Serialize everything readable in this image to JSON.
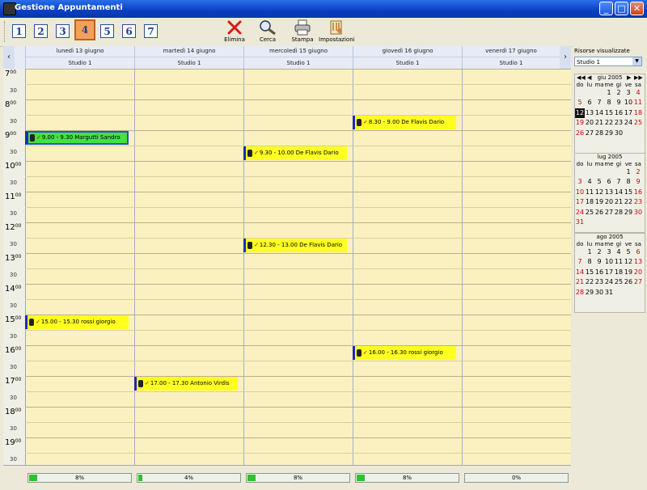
{
  "window": {
    "title": "Gestione Appuntamenti"
  },
  "toolbar": {
    "day_buttons": [
      "1",
      "2",
      "3",
      "4",
      "5",
      "6",
      "7"
    ],
    "active_day": "4",
    "tools": [
      {
        "label": "Elimina",
        "icon": "delete-x-icon"
      },
      {
        "label": "Cerca",
        "icon": "search-icon"
      },
      {
        "label": "Stampa",
        "icon": "printer-icon"
      },
      {
        "label": "Impostazioni",
        "icon": "settings-icon"
      }
    ]
  },
  "calendar": {
    "days": [
      {
        "name": "lunedì 13 giugno",
        "studio": "Studio 1",
        "load": "8%",
        "load_value": 0.08
      },
      {
        "name": "martedì 14 giugno",
        "studio": "Studio 1",
        "load": "4%",
        "load_value": 0.04
      },
      {
        "name": "mercoledì 15 giugno",
        "studio": "Studio 1",
        "load": "8%",
        "load_value": 0.08
      },
      {
        "name": "giovedì 16 giugno",
        "studio": "Studio 1",
        "load": "8%",
        "load_value": 0.08
      },
      {
        "name": "venerdì 17 giugno",
        "studio": "Studio 1",
        "load": "0%",
        "load_value": 0
      }
    ],
    "hours": [
      "7",
      "8",
      "9",
      "10",
      "11",
      "12",
      "13",
      "14",
      "15",
      "16",
      "17",
      "18",
      "19"
    ],
    "hour_suffix": "00",
    "half_label": "30",
    "appointments": [
      {
        "day": 0,
        "start": "9.00",
        "text": "9.00 - 9.30 Margutti Sandro",
        "selected": true
      },
      {
        "day": 3,
        "start": "8.30",
        "text": "8.30 - 9.00 De Flavis Dario",
        "selected": false
      },
      {
        "day": 2,
        "start": "9.30",
        "text": "9.30 - 10.00 De Flavis Dario",
        "selected": false
      },
      {
        "day": 2,
        "start": "12.30",
        "text": "12.30 - 13.00 De Flavis Dario",
        "selected": false
      },
      {
        "day": 0,
        "start": "15.00",
        "text": "15.00 - 15.30 rossi giorgio",
        "selected": false
      },
      {
        "day": 3,
        "start": "16.00",
        "text": "16.00 - 16.30 rossi giorgio",
        "selected": false
      },
      {
        "day": 1,
        "start": "17.00",
        "text": "17.00 - 17.30 Antonio Virdis",
        "selected": false
      }
    ]
  },
  "resources": {
    "label": "Risorse visualizzate",
    "selected": "Studio 1"
  },
  "mini_calendars": [
    {
      "title": "giu 2005",
      "weekdays": [
        "do",
        "lu",
        "ma",
        "me",
        "gi",
        "ve",
        "sa"
      ],
      "cells": [
        "",
        "",
        "",
        "1",
        "2",
        "3",
        "4",
        "5",
        "6",
        "7",
        "8",
        "9",
        "10",
        "11",
        "12",
        "13",
        "14",
        "15",
        "16",
        "17",
        "18",
        "19",
        "20",
        "21",
        "22",
        "23",
        "24",
        "25",
        "26",
        "27",
        "28",
        "29",
        "30",
        "",
        ""
      ],
      "today": "12"
    },
    {
      "title": "lug 2005",
      "weekdays": [
        "do",
        "lu",
        "ma",
        "me",
        "gi",
        "ve",
        "sa"
      ],
      "cells": [
        "",
        "",
        "",
        "",
        "",
        "1",
        "2",
        "3",
        "4",
        "5",
        "6",
        "7",
        "8",
        "9",
        "10",
        "11",
        "12",
        "13",
        "14",
        "15",
        "16",
        "17",
        "18",
        "19",
        "20",
        "21",
        "22",
        "23",
        "24",
        "25",
        "26",
        "27",
        "28",
        "29",
        "30",
        "31"
      ]
    },
    {
      "title": "ago 2005",
      "weekdays": [
        "do",
        "lu",
        "ma",
        "me",
        "gi",
        "ve",
        "sa"
      ],
      "cells": [
        "",
        "1",
        "2",
        "3",
        "4",
        "5",
        "6",
        "7",
        "8",
        "9",
        "10",
        "11",
        "12",
        "13",
        "14",
        "15",
        "16",
        "17",
        "18",
        "19",
        "20",
        "21",
        "22",
        "23",
        "24",
        "25",
        "26",
        "27",
        "28",
        "29",
        "30",
        "31",
        "",
        "",
        ""
      ]
    }
  ]
}
